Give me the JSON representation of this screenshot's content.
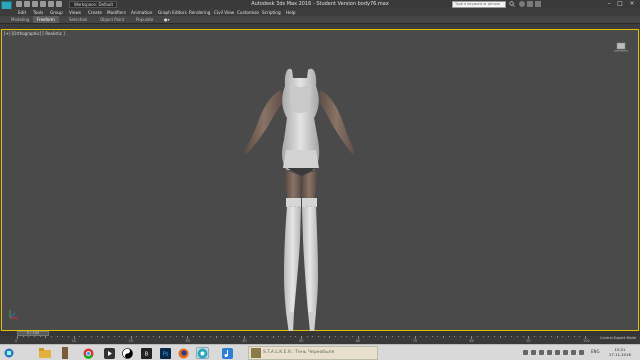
{
  "app": {
    "title": "Autodesk 3ds Max 2016 - Student Version   body76.max",
    "workspace": "Workspace: Default",
    "search_placeholder": "Type a keyword or phrase",
    "accent": "#e0c000"
  },
  "menu": {
    "items": [
      "Edit",
      "Tools",
      "Group",
      "Views",
      "Create",
      "Modifiers",
      "Animation",
      "Graph Editors",
      "Rendering",
      "Civil View",
      "Customize",
      "Scripting",
      "Help"
    ]
  },
  "ribbon": {
    "tabs": [
      "Modeling",
      "Freeform",
      "Selection",
      "Object Paint",
      "Populate"
    ],
    "active_tab": "Freeform"
  },
  "viewport": {
    "label": "[+] [Orthographic] [ Realistic ]"
  },
  "timeline": {
    "frame": "0 / 100",
    "ticks": [
      "0",
      "10",
      "20",
      "30",
      "40",
      "50",
      "60",
      "70",
      "80",
      "90",
      "100"
    ],
    "mode": "Control Expert Mode"
  },
  "taskbar": {
    "apps": [
      "start-icon",
      "folder-icon",
      "character-icon",
      "chrome-icon",
      "media-icon",
      "yinyang-icon",
      "bits-icon",
      "photoshop-icon",
      "firefox-icon",
      "3dsmax-icon",
      "music-icon"
    ],
    "window_label": "S.T.A.L.K.E.R.: Тень Чернобыля",
    "language": "ENG",
    "time": "15:21",
    "date": "27.11.2016"
  }
}
